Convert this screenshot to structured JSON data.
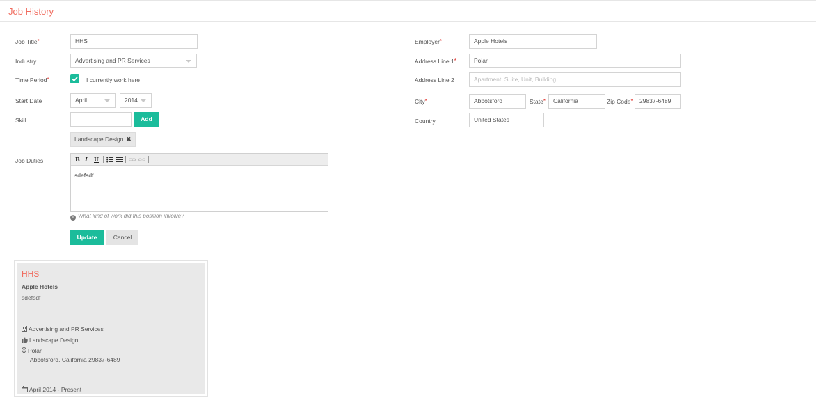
{
  "header": {
    "title": "Job History"
  },
  "form": {
    "job_title": {
      "label": "Job Title",
      "value": "HHS"
    },
    "industry": {
      "label": "Industry",
      "value": "Advertising and PR Services"
    },
    "time_period": {
      "label": "Time Period",
      "checkbox_label": "I currently work here",
      "checked": true
    },
    "start_date": {
      "label": "Start Date",
      "month": "April",
      "year": "2014"
    },
    "skill": {
      "label": "Skill",
      "value": "",
      "add_label": "Add",
      "tags": [
        "Landscape Design"
      ]
    },
    "job_duties": {
      "label": "Job Duties",
      "toolbar": [
        "B",
        "I",
        "U"
      ],
      "content": "sdefsdf",
      "hint": "What kind of work did this position involve?"
    },
    "employer": {
      "label": "Employer",
      "value": "Apple Hotels"
    },
    "address1": {
      "label": "Address Line 1",
      "value": "Polar"
    },
    "address2": {
      "label": "Address Line 2",
      "value": "",
      "placeholder": "Apartment, Suite, Unit, Building"
    },
    "city": {
      "label": "City",
      "value": "Abbotsford"
    },
    "state": {
      "label": "State",
      "value": "California"
    },
    "zip": {
      "label": "Zip Code",
      "value": "29837-6489"
    },
    "country": {
      "label": "Country",
      "value": "United States"
    },
    "update_label": "Update",
    "cancel_label": "Cancel"
  },
  "card": {
    "title": "HHS",
    "employer": "Apple Hotels",
    "duties": "sdefsdf",
    "industry": "Advertising and PR Services",
    "skill": "Landscape Design",
    "address_line1": "Polar,",
    "address_line2": "Abbotsford, California 29837-6489",
    "period": "April 2014 -  Present"
  },
  "colors": {
    "accent": "#1bbc9b",
    "title": "#f06b5e",
    "required": "#e0302a"
  }
}
